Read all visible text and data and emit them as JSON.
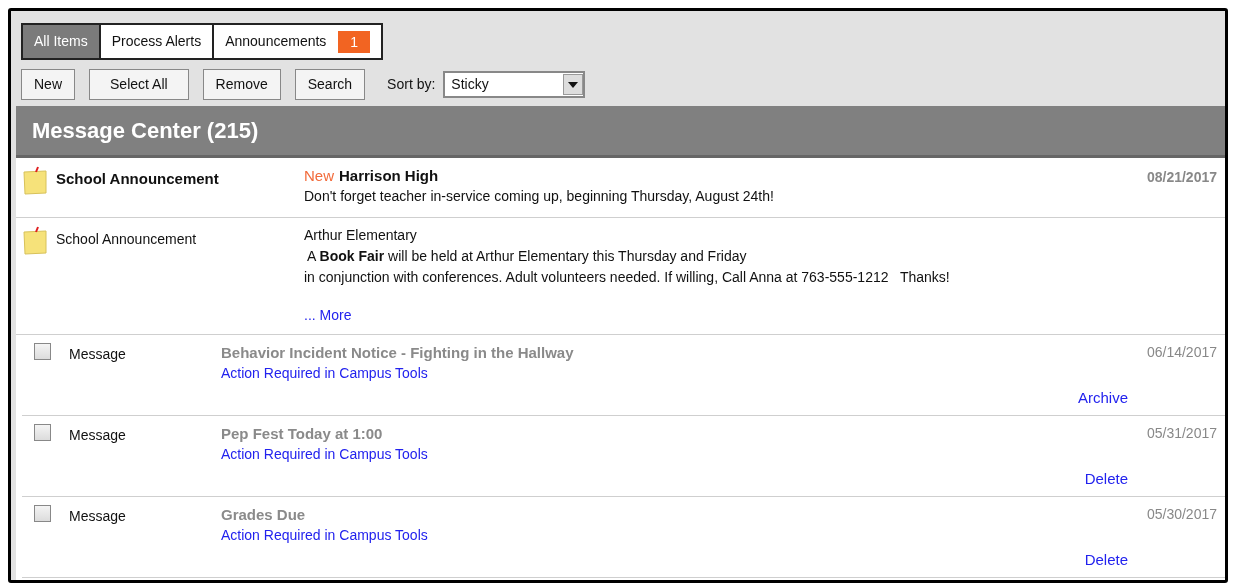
{
  "tabs": [
    {
      "label": "All Items",
      "selected": true
    },
    {
      "label": "Process Alerts",
      "selected": false
    },
    {
      "label": "Announcements",
      "selected": false,
      "badge": "1"
    }
  ],
  "toolbar": {
    "buttons": [
      "New",
      "Select All",
      "Remove",
      "Search"
    ],
    "sort_label": "Sort by:",
    "sort_value": "Sticky"
  },
  "header": "Message Center (215)",
  "items": [
    {
      "kind": "announcement",
      "type": "School Announcement",
      "unread": true,
      "new_label": "New",
      "title": "Harrison High",
      "lines": [
        "Don't forget teacher in-service coming up, beginning Thursday, August 24th!"
      ],
      "date": "08/21/2017"
    },
    {
      "kind": "announcement",
      "type": "School Announcement",
      "unread": false,
      "title": "Arthur Elementary",
      "lines": [
        " A **Book Fair** will be held at Arthur Elementary this Thursday and Friday",
        "in conjunction with conferences. Adult volunteers needed. If willing, Call Anna at 763-555-1212   Thanks!"
      ],
      "more": "... More"
    },
    {
      "kind": "message",
      "type": "Message",
      "checked": false,
      "title": "Behavior Incident Notice - Fighting in the Hallway",
      "link": "Action Required in Campus Tools",
      "action": "Archive",
      "date": "06/14/2017"
    },
    {
      "kind": "message",
      "type": "Message",
      "checked": false,
      "title": "Pep Fest Today at 1:00",
      "link": "Action Required in Campus Tools",
      "action": "Delete",
      "date": "05/31/2017"
    },
    {
      "kind": "message",
      "type": "Message",
      "checked": false,
      "title": "Grades Due",
      "link": "Action Required in Campus Tools",
      "action": "Delete",
      "date": "05/30/2017"
    }
  ]
}
